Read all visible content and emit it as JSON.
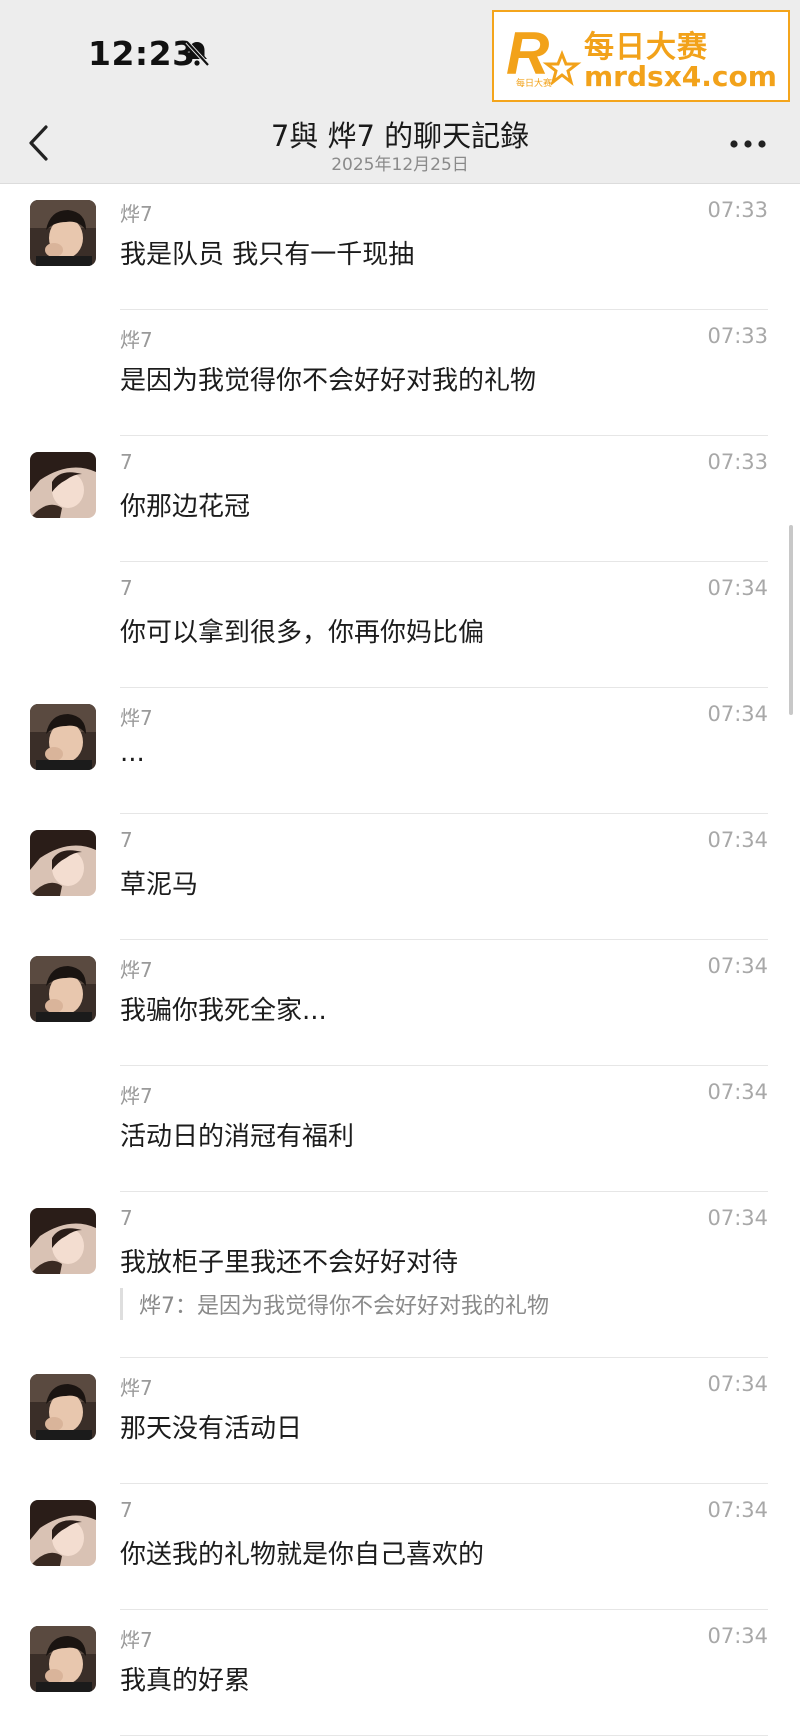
{
  "status": {
    "time": "12:23"
  },
  "watermark": {
    "brand_cn": "每日大赛",
    "url": "mrdsx4.com",
    "logo_text": "每日大赛",
    "color": "#f2a21a"
  },
  "nav": {
    "title": "7與 烨7 的聊天記錄",
    "date": "2025年12月25日"
  },
  "messages": [
    {
      "sender": "烨7",
      "time": "07:33",
      "text": "我是队员 我只有一千现抽",
      "avatar": "male"
    },
    {
      "sender": "烨7",
      "time": "07:33",
      "text": "是因为我觉得你不会好好对我的礼物",
      "avatar": ""
    },
    {
      "sender": "7",
      "time": "07:33",
      "text": "你那边花冠",
      "avatar": "female"
    },
    {
      "sender": "7",
      "time": "07:34",
      "text": "你可以拿到很多，你再你妈比偏",
      "avatar": ""
    },
    {
      "sender": "烨7",
      "time": "07:34",
      "text": "...",
      "avatar": "male"
    },
    {
      "sender": "7",
      "time": "07:34",
      "text": "草泥马",
      "avatar": "female"
    },
    {
      "sender": "烨7",
      "time": "07:34",
      "text": "我骗你我死全家...",
      "avatar": "male"
    },
    {
      "sender": "烨7",
      "time": "07:34",
      "text": "活动日的消冠有福利",
      "avatar": ""
    },
    {
      "sender": "7",
      "time": "07:34",
      "text": "我放柜子里我还不会好好对待",
      "avatar": "female",
      "quote": "烨7：是因为我觉得你不会好好对我的礼物"
    },
    {
      "sender": "烨7",
      "time": "07:34",
      "text": "那天没有活动日",
      "avatar": "male"
    },
    {
      "sender": "7",
      "time": "07:34",
      "text": "你送我的礼物就是你自己喜欢的",
      "avatar": "female"
    },
    {
      "sender": "烨7",
      "time": "07:34",
      "text": "我真的好累",
      "avatar": "male"
    }
  ]
}
